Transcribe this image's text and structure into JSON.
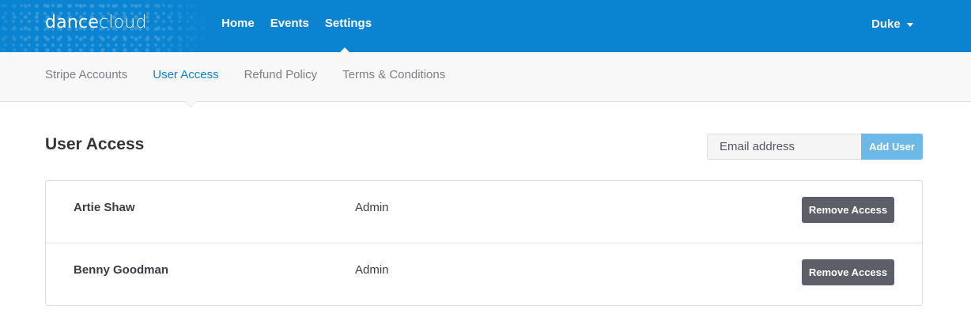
{
  "header": {
    "logo_part1": "dance",
    "logo_part2": "cloud",
    "nav": [
      "Home",
      "Events",
      "Settings"
    ],
    "user_name": "Duke"
  },
  "subnav": {
    "tabs": [
      "Stripe Accounts",
      "User Access",
      "Refund Policy",
      "Terms & Conditions"
    ],
    "active": "User Access"
  },
  "main": {
    "title": "User Access",
    "email_placeholder": "Email address",
    "add_button": "Add User",
    "users": [
      {
        "name": "Artie Shaw",
        "role": "Admin",
        "action": "Remove Access"
      },
      {
        "name": "Benny Goodman",
        "role": "Admin",
        "action": "Remove Access"
      }
    ]
  },
  "colors": {
    "brand_blue": "#0a84d0",
    "add_button": "#6cb8e6",
    "remove_button": "#5c5e68"
  }
}
